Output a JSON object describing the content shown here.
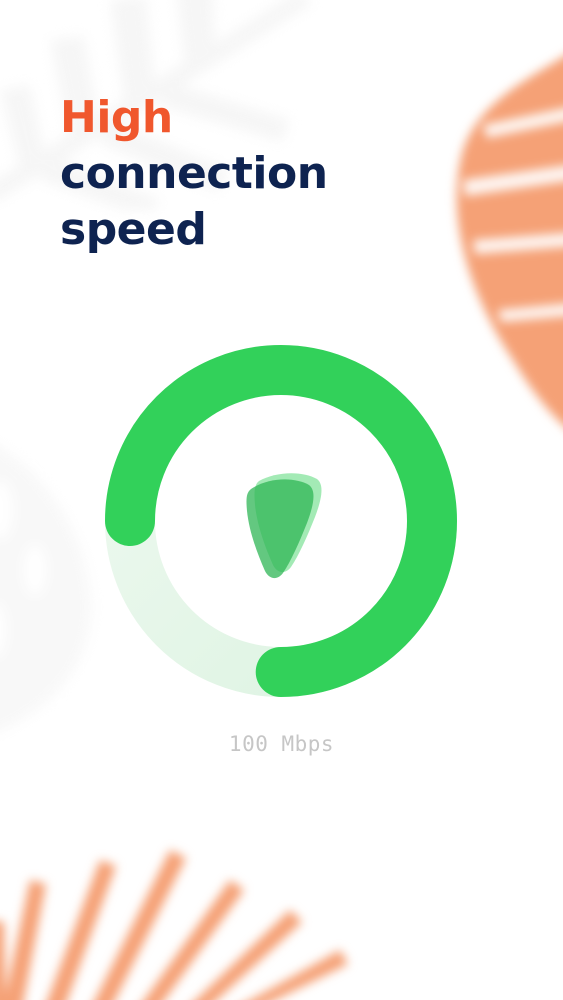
{
  "headline": {
    "accent": "High",
    "rest_line1": "connection",
    "rest_line2": "speed"
  },
  "speed": {
    "label": "100 Mbps",
    "gauge_fill_fraction": 0.75
  },
  "colors": {
    "accent_orange": "#f0572d",
    "navy": "#0e2350",
    "gauge_green": "#32d15a",
    "gauge_track": "#e3f5e6",
    "leaf_orange": "#f5a176",
    "leaf_grey": "#eeeeee",
    "label_grey": "#c6c6c6"
  },
  "icons": {
    "center": "shield-drop-icon",
    "decor": [
      "leaf-decoration"
    ]
  }
}
